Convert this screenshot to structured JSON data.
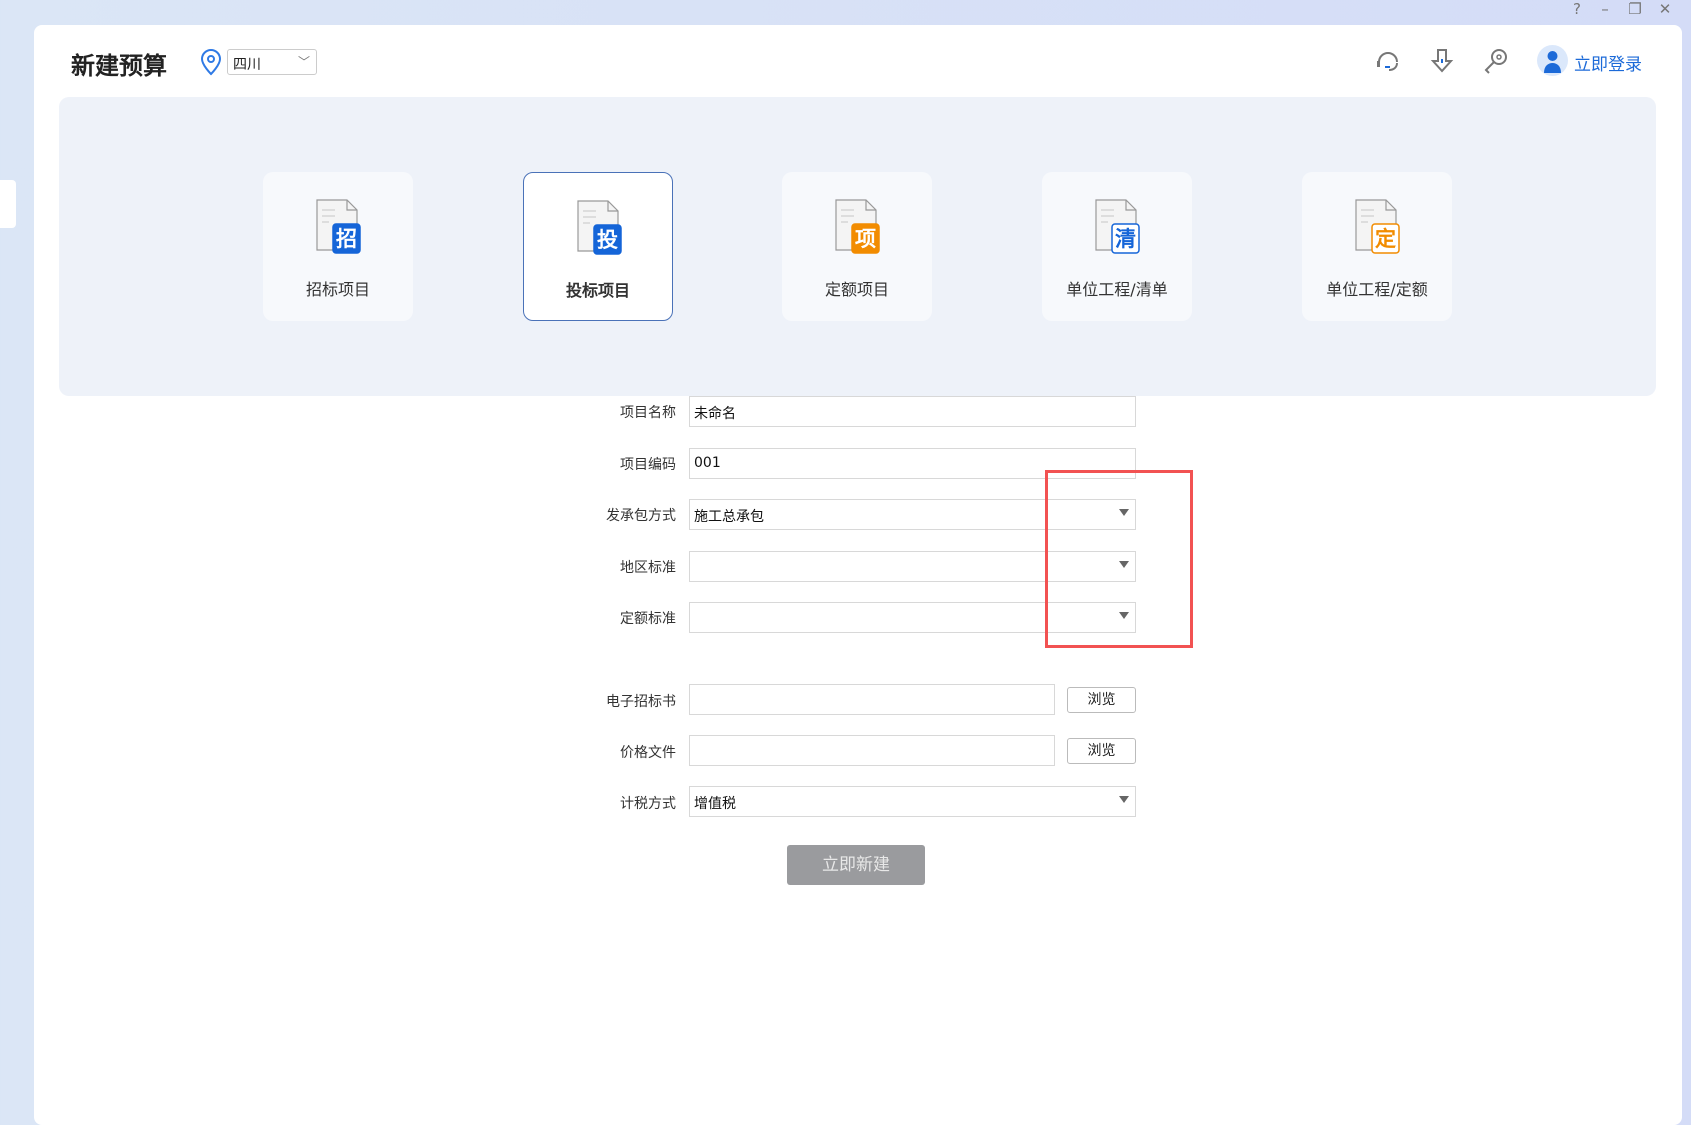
{
  "window_controls": {
    "help": "?",
    "minimize": "–",
    "restore": "❐",
    "close": "✕"
  },
  "header": {
    "title": "新建预算",
    "region": "四川",
    "login": "立即登录",
    "icons": [
      "headset-icon",
      "download-icon",
      "key-icon",
      "user-avatar"
    ]
  },
  "cards": [
    {
      "label": "招标项目",
      "badge": "招",
      "color": "#1565d8",
      "style": "solid"
    },
    {
      "label": "投标项目",
      "badge": "投",
      "color": "#1565d8",
      "style": "solid",
      "selected": true
    },
    {
      "label": "定额项目",
      "badge": "项",
      "color": "#f28c00",
      "style": "solid"
    },
    {
      "label": "单位工程/清单",
      "badge": "清",
      "color": "#1565d8",
      "style": "outline"
    },
    {
      "label": "单位工程/定额",
      "badge": "定",
      "color": "#f28c00",
      "style": "outline"
    }
  ],
  "form": {
    "project_name": {
      "label": "项目名称",
      "value": "未命名"
    },
    "project_code": {
      "label": "项目编码",
      "value": "001"
    },
    "contract_mode": {
      "label": "发承包方式",
      "value": "施工总承包"
    },
    "region_standard": {
      "label": "地区标准",
      "value": ""
    },
    "quota_standard": {
      "label": "定额标准",
      "value": ""
    },
    "tender_file": {
      "label": "电子招标书",
      "value": "",
      "browse": "浏览"
    },
    "price_file": {
      "label": "价格文件",
      "value": "",
      "browse": "浏览"
    },
    "tax_mode": {
      "label": "计税方式",
      "value": "增值税"
    },
    "submit": "立即新建"
  },
  "colors": {
    "accent": "#1c6ad8",
    "highlight_box": "#f25252",
    "submit_disabled": "#9a9b9e"
  }
}
